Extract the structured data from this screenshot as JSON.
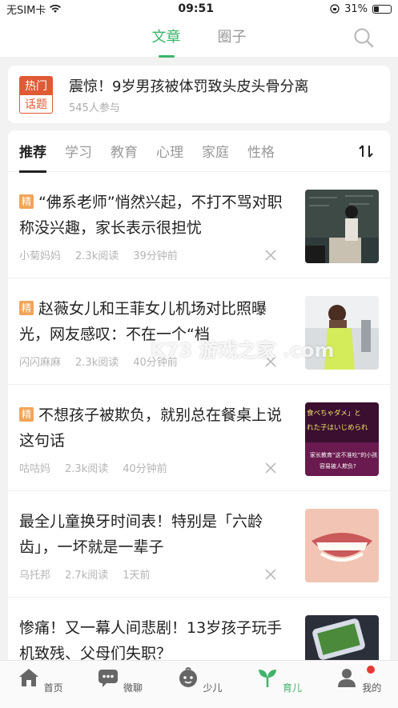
{
  "status_bar": {
    "carrier": "无SIM卡",
    "time": "09:51",
    "battery": "31%",
    "battery_level": 0.31
  },
  "top_tabs": [
    {
      "label": "文章",
      "active": true
    },
    {
      "label": "圈子",
      "active": false
    }
  ],
  "hot_topic": {
    "badge_top": "热门",
    "badge_bottom": "话题",
    "title": "震惊！9岁男孩被体罚致头皮头骨分离",
    "participants": "545人参与"
  },
  "categories": [
    "推荐",
    "学习",
    "教育",
    "心理",
    "家庭",
    "性格"
  ],
  "sort_icon": "sort-icon",
  "articles": [
    {
      "featured": true,
      "badge": "精",
      "title": "“佛系老师”悄然兴起，不打不骂对职称没兴趣，家长表示很担忧",
      "author": "小菊妈妈",
      "reads": "2.3k阅读",
      "time": "39分钟前"
    },
    {
      "featured": true,
      "badge": "精",
      "title": "赵薇女儿和王菲女儿机场对比照曝光，网友感叹：不在一个“档",
      "author": "闪闪麻麻",
      "reads": "2.3k阅读",
      "time": "40分钟前"
    },
    {
      "featured": true,
      "badge": "精",
      "title": "不想孩子被欺负，就别总在餐桌上说这句话",
      "author": "咕咕妈",
      "reads": "2.3k阅读",
      "time": "40分钟前",
      "thumb_text_1": "食べちゃダメ」と",
      "thumb_text_2": "れた子はいじめられ",
      "thumb_text_3": "家长教育“这不准吃”的小孩",
      "thumb_text_4": "容易被人欺负?"
    },
    {
      "featured": false,
      "title": "最全儿童换牙时间表！特别是「六龄齿」，一坏就是一辈子",
      "author": "乌托邦",
      "reads": "2.7k阅读",
      "time": "1天前"
    },
    {
      "featured": false,
      "title": "惨痛！又一幕人间悲剧！13岁孩子玩手机致残、父母们失职？",
      "author": "",
      "reads": "",
      "time": ""
    }
  ],
  "watermark": "K73 游戏之家 .com",
  "bottom_nav": [
    {
      "label": "首页",
      "icon": "home-icon",
      "active": false
    },
    {
      "label": "微聊",
      "icon": "chat-icon",
      "active": false
    },
    {
      "label": "少儿",
      "icon": "child-icon",
      "active": false
    },
    {
      "label": "育儿",
      "icon": "sprout-icon",
      "active": true
    },
    {
      "label": "我的",
      "icon": "profile-icon",
      "active": false,
      "notification": true
    }
  ],
  "colors": {
    "accent": "#3eb36b",
    "hot": "#e05a36",
    "badge": "#f0a55a"
  }
}
